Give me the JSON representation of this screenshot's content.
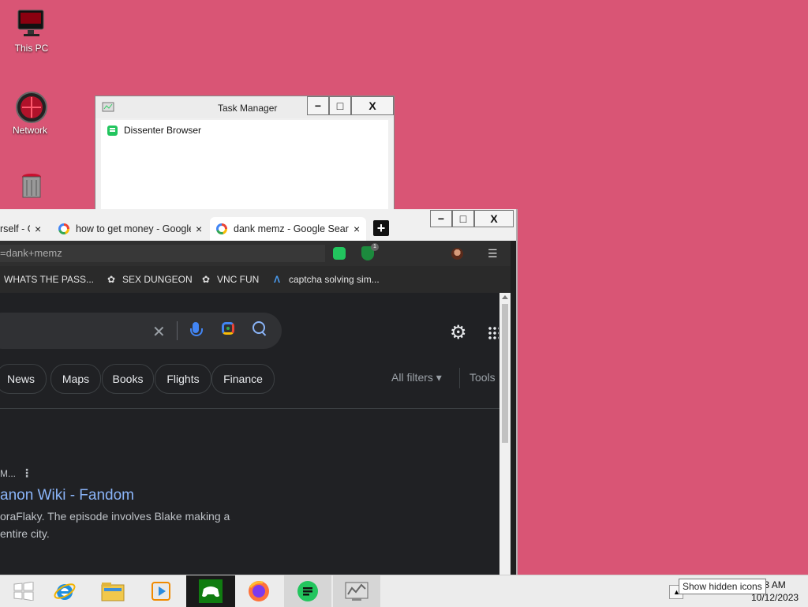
{
  "desktop": {
    "icons": [
      {
        "label": "This PC"
      },
      {
        "label": "Network"
      },
      {
        "label": ""
      }
    ]
  },
  "task_manager": {
    "title": "Task Manager",
    "minimize": "−",
    "maximize": "□",
    "close": "X",
    "rows": [
      {
        "name": "Dissenter Browser"
      }
    ]
  },
  "browser": {
    "window_buttons": {
      "minimize": "−",
      "maximize": "□",
      "close": "X"
    },
    "tabs": [
      {
        "label": "rself - G",
        "close": "×"
      },
      {
        "label": "how to get money - Google",
        "close": "×"
      },
      {
        "label": "dank memz - Google Search",
        "close": "×"
      }
    ],
    "new_tab": "+",
    "address": "=dank+memz",
    "extension_badge": "1",
    "menu": "☰",
    "bookmarks": [
      {
        "label": "WHATS THE PASS..."
      },
      {
        "label": "SEX DUNGEON"
      },
      {
        "label": "VNC FUN"
      },
      {
        "label": "captcha solving sim..."
      }
    ],
    "search": {
      "clear": "✕"
    },
    "filters": [
      "News",
      "Maps",
      "Books",
      "Flights",
      "Finance"
    ],
    "all_filters": "All filters ▾",
    "tools": "Tools",
    "result": {
      "source": "M...",
      "title": "anon Wiki - Fandom",
      "snippet_line1": "oraFlaky. The episode involves Blake making a",
      "snippet_line2": "entire city."
    }
  },
  "taskbar": {
    "clock_time": "3 AM",
    "clock_date": "10/12/2023",
    "tooltip": "Show hidden icons",
    "apps": [
      "start",
      "internet-explorer",
      "file-explorer",
      "media-player",
      "xbox",
      "firefox",
      "dissenter",
      "task-manager"
    ]
  },
  "colors": {
    "desktop": "#d95575",
    "dark_bg": "#202124",
    "link": "#8ab4f8",
    "green": "#22c55e"
  }
}
